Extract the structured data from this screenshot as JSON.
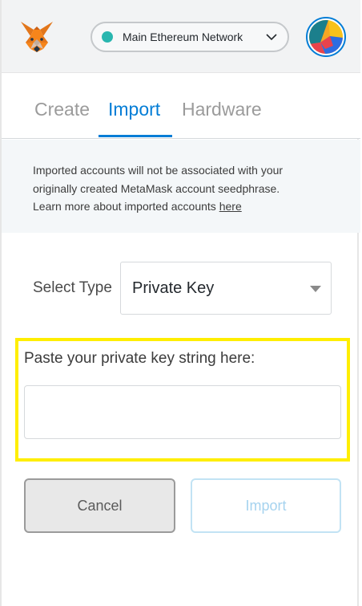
{
  "header": {
    "logo_icon": "metamask-fox-icon",
    "network": {
      "label": "Main Ethereum Network",
      "dot_color": "#29b6af",
      "chevron_icon": "chevron-down-icon"
    },
    "account_avatar_icon": "account-identicon-icon"
  },
  "tabs": [
    {
      "label": "Create",
      "active": false
    },
    {
      "label": "Import",
      "active": true
    },
    {
      "label": "Hardware",
      "active": false
    }
  ],
  "info": {
    "line1": "Imported accounts will not be associated with your",
    "line2": "originally created MetaMask account seedphrase.",
    "line3_prefix": "Learn more about imported accounts ",
    "link_text": "here"
  },
  "import_form": {
    "select_type_label": "Select Type",
    "select_value": "Private Key",
    "caret_icon": "caret-down-icon",
    "private_key_label": "Paste your private key string here:",
    "private_key_value": "",
    "cancel_label": "Cancel",
    "import_label": "Import"
  },
  "colors": {
    "accent": "#037dd6",
    "highlight": "#ffee00"
  }
}
